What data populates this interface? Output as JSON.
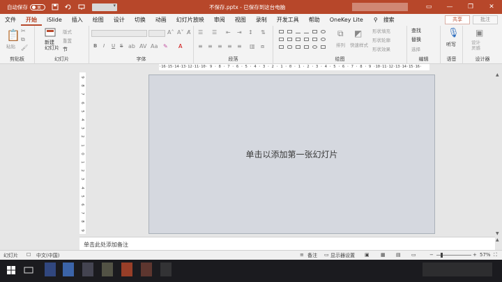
{
  "titlebar": {
    "autosave_label": "自动保存",
    "autosave_state": "关",
    "document_title": "不保存.pptx - 已保存到这台电脑",
    "accent_color": "#b7472a",
    "icons": [
      "save-icon",
      "undo-icon",
      "redo-icon",
      "present-icon"
    ]
  },
  "tabs": {
    "items": [
      "文件",
      "开始",
      "iSlide",
      "插入",
      "绘图",
      "设计",
      "切换",
      "动画",
      "幻灯片放映",
      "审阅",
      "视图",
      "录制",
      "开发工具",
      "帮助",
      "OneKey Lite"
    ],
    "active": "开始",
    "search_label": "搜索",
    "share_label": "共享",
    "comment_label": "批注"
  },
  "ribbon": {
    "clipboard": {
      "label": "剪贴板",
      "paste": "粘贴"
    },
    "slides": {
      "label": "幻灯片",
      "new_slide": "新建\n幻灯片",
      "layout": "版式",
      "reset": "重置",
      "section": "节"
    },
    "font": {
      "label": "字体",
      "bold": "B",
      "italic": "I",
      "underline": "U",
      "strike": "S"
    },
    "paragraph": {
      "label": "段落"
    },
    "drawing": {
      "label": "绘图",
      "arrange": "排列",
      "quick_styles": "快速样式",
      "shape_fill": "形状填充",
      "shape_outline": "形状轮廓",
      "shape_effects": "形状效果"
    },
    "editing": {
      "label": "编辑",
      "find": "查找",
      "replace": "替换",
      "select": "选择"
    },
    "voice": {
      "label": "语音",
      "dictate": "听写"
    },
    "designer": {
      "label": "设计器",
      "design_ideas": "设计\n灵感"
    }
  },
  "ruler": {
    "horizontal": "·16·15·14·13·12·11·10· 9 · 8 · 7 · 6 · 5 · 4 · 3 · 2 · 1 · 0 · 1 · 2 · 3 · 4 · 5 · 6 · 7 · 8 · 9 ·10·11·12·13·14·15·16·",
    "vertical": [
      "9",
      "8",
      "7",
      "6",
      "5",
      "4",
      "3",
      "2",
      "1",
      "0",
      "1",
      "2",
      "3",
      "4",
      "5",
      "6",
      "7",
      "8",
      "9"
    ]
  },
  "slide": {
    "placeholder": "单击以添加第一张幻灯片"
  },
  "notes": {
    "placeholder": "单击此处添加备注"
  },
  "status": {
    "slide_label": "幻灯片",
    "language": "中文(中国)",
    "notes_btn": "备注",
    "display_settings": "显示器设置",
    "zoom": "57%"
  }
}
